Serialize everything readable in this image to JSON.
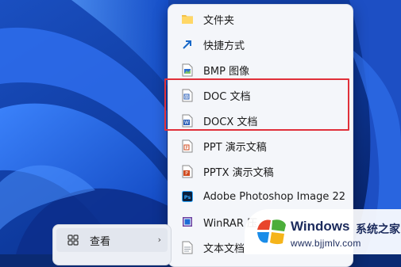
{
  "context_menu": {
    "items": [
      {
        "label": "文件夹",
        "icon": "folder-icon"
      },
      {
        "label": "快捷方式",
        "icon": "shortcut-arrow-icon"
      },
      {
        "label": "BMP 图像",
        "icon": "bmp-image-icon"
      },
      {
        "label": "DOC 文档",
        "icon": "word-doc-icon"
      },
      {
        "label": "DOCX 文档",
        "icon": "word-docx-icon"
      },
      {
        "label": "PPT 演示文稿",
        "icon": "ppt-icon"
      },
      {
        "label": "PPTX 演示文稿",
        "icon": "pptx-icon"
      },
      {
        "label": "Adobe Photoshop Image 22",
        "icon": "photoshop-icon"
      },
      {
        "label": "WinRAR 压",
        "icon": "winrar-icon"
      },
      {
        "label": "文本文档",
        "icon": "text-document-icon"
      }
    ],
    "highlighted_items": [
      "DOC 文档",
      "DOCX 文档"
    ],
    "highlight_color": "#e0303a"
  },
  "parent_menu": {
    "item_label": "查看",
    "icon": "view-grid-icon",
    "chevron": "›"
  },
  "watermark": {
    "title": "Windows",
    "subtitle_cn": "系统之家",
    "url": "www.bjjmlv.com"
  },
  "colors": {
    "menu_background": "#f4f6fa",
    "wallpaper_blue": "#1e5bd6"
  }
}
